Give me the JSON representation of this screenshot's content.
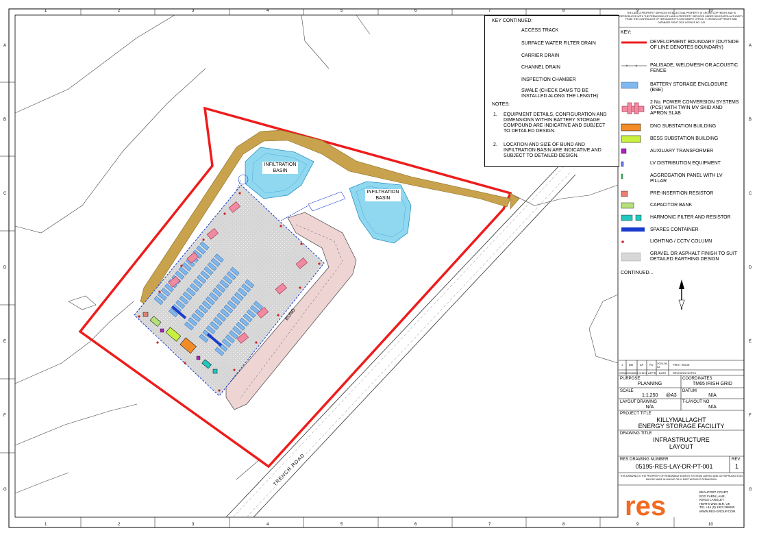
{
  "grid": {
    "columns": [
      "1",
      "2",
      "3",
      "4",
      "5",
      "6",
      "7",
      "8",
      "9",
      "10"
    ],
    "rows": [
      "A",
      "B",
      "C",
      "D",
      "E",
      "F",
      "G"
    ]
  },
  "map_labels": {
    "infiltration_basin_1": [
      "INFILTRATION",
      "BASIN"
    ],
    "infiltration_basin_2": [
      "INFILTRATION",
      "BASIN"
    ],
    "bund": "BUND",
    "road": "TRENCH ROAD"
  },
  "key_continued": {
    "heading": "KEY CONTINUED:",
    "items": [
      {
        "label": "ACCESS TRACK",
        "icon": "access-track-swatch"
      },
      {
        "label": "SURFACE WATER FILTER DRAIN",
        "icon": "filter-drain-line"
      },
      {
        "label": "CARRIER DRAIN",
        "icon": "carrier-drain-line"
      },
      {
        "label": "CHANNEL DRAIN",
        "icon": "channel-drain-line"
      },
      {
        "label": "INSPECTION CHAMBER",
        "icon": "inspection-chamber-dot"
      },
      {
        "label": "SWALE  (CHECK DAMS TO BE INSTALLED ALONG THE LENGTH)",
        "icon": "swale-lines"
      }
    ],
    "notes_heading": "NOTES:",
    "notes": [
      {
        "num": "1.",
        "text": "EQUIPMENT DETAILS, CONFIGURATION AND DIMENSIONS WITHIN BATTERY STORAGE COMPOUND ARE INDICATIVE AND SUBJECT TO DETAILED DESIGN."
      },
      {
        "num": "2.",
        "text": "LOCATION AND SIZE OF BUND AND INFILTRATION BASIN ARE INDICATIVE AND SUBJECT TO DETAILED DESIGN."
      }
    ]
  },
  "copyright": "THE LAND & PROPERTY SERVICES INTELLECTUAL PROPERTY IS CROWN COPYRIGHT AND IS REPRODUCED WITH THE PERMISSION OF LAND & PROPERTY SERVICES UNDER DELEGATED AUTHORITY FROM THE CONTROLLER OF HER MAJESTY'S STATIONERY OFFICE, © CROWN COPYRIGHT AND DATABASE RIGHT 2020 LICENCE NO. 243",
  "key": {
    "heading": "KEY:",
    "items": [
      {
        "label": "DEVELOPMENT  BOUNDARY (OUTSIDE OF LINE DENOTES BOUNDARY)",
        "icon": "boundary-line"
      },
      {
        "label": "PALISADE, WELDMESH OR ACOUSTIC FENCE",
        "icon": "fence-line"
      },
      {
        "label": "BATTERY STORAGE ENCLOSURE (BSE)",
        "icon": "bse-swatch"
      },
      {
        "label": "2 No. POWER CONVERSION SYSTEMS (PCS) WITH  TWIN MV SKID AND APRON SLAB",
        "icon": "pcs-symbol"
      },
      {
        "label": "DNO SUBSTATION BUILDING",
        "icon": "dno-swatch"
      },
      {
        "label": "BESS SUBSTATION BUILDING",
        "icon": "bess-swatch"
      },
      {
        "label": "AUXILIARY TRANSFORMER",
        "icon": "aux-transformer-swatch"
      },
      {
        "label": "LV DISTRIBUTION EQUIPMENT",
        "icon": "lv-distribution-swatch"
      },
      {
        "label": "AGGREGATION PANEL WITH LV PILLAR",
        "icon": "aggregation-panel-swatch"
      },
      {
        "label": "PRE-INSERTION RESISTOR",
        "icon": "resistor-swatch"
      },
      {
        "label": "CAPACITOR BANK",
        "icon": "capacitor-swatch"
      },
      {
        "label": "HARMONIC FILTER AND RESISTOR",
        "icon": "harmonic-filter-swatch"
      },
      {
        "label": "SPARES CONTAINER",
        "icon": "spares-swatch"
      },
      {
        "label": "LIGHTING / CCTV COLUMN",
        "icon": "lighting-dot"
      },
      {
        "label": "GRAVEL OR ASPHALT FINISH TO SUIT DETAILED EARTHING DESIGN",
        "icon": "gravel-swatch"
      }
    ],
    "continued": "CONTINUED..."
  },
  "revision": {
    "row": [
      "1",
      "BM",
      "AP",
      "PD",
      "2024-06-02",
      "FIRST ISSUE"
    ],
    "headers": [
      "ISSUE",
      "DRAWN",
      "CHK'D",
      "APP'D",
      "DATE",
      "REVISION NOTES"
    ]
  },
  "title_block": {
    "purpose_label": "PURPOSE",
    "purpose": "PLANNING",
    "coordinates_label": "COORDINATES",
    "coordinates": "TM65 IRISH GRID",
    "scale_label": "SCALE",
    "scale": "1:1,250",
    "paper": "@A3",
    "datum_label": "DATUM",
    "datum": "N/A",
    "layout_drawing_label": "LAYOUT DRAWING",
    "layout_drawing": "N/A",
    "t_layout_label": "T-LAYOUT NO",
    "t_layout": "N/A",
    "project_title_label": "PROJECT TITLE",
    "project_title": [
      "KILLYMALLAGHT",
      "ENERGY STORAGE FACILITY"
    ],
    "drawing_title_label": "DRAWING TITLE",
    "drawing_title": [
      "INFRASTRUCTURE",
      "LAYOUT"
    ],
    "drawing_number_label": "RES DRAWING NUMBER",
    "drawing_number": "05195-RES-LAY-DR-PT-001",
    "rev_label": "REV",
    "rev": "1",
    "property_note": "THIS DRAWING IS THE PROPERTY OF RENEWABLE ENERGY SYSTEMS LIMITED AND NO REPRODUCTION MAY BE MADE IN WHOLE OR IN PART WITHOUT PERMISSION",
    "logo_text": "res",
    "address": [
      "BEAUFORT COURT,",
      "EGG FARM LANE,",
      "KINGS LANGLEY",
      "HERTS WD4 8LR, UK",
      "TEL +44 (0) 1923 299200",
      "WWW.RES-GROUP.COM"
    ]
  },
  "colors": {
    "boundary": "#ee1c1c",
    "access_track": "#c8a24c",
    "basin": "#8fd8f0",
    "bund": "#efd4d4",
    "bse": "#7fb8ee",
    "pcs": "#f08aa0",
    "dno": "#f28c28",
    "bess": "#c8f040",
    "aux": "#b020c0",
    "spares": "#1a3ccc",
    "harmonic": "#20c8c0",
    "logo": "#f26a21",
    "gravel": "#d8d8d8"
  }
}
